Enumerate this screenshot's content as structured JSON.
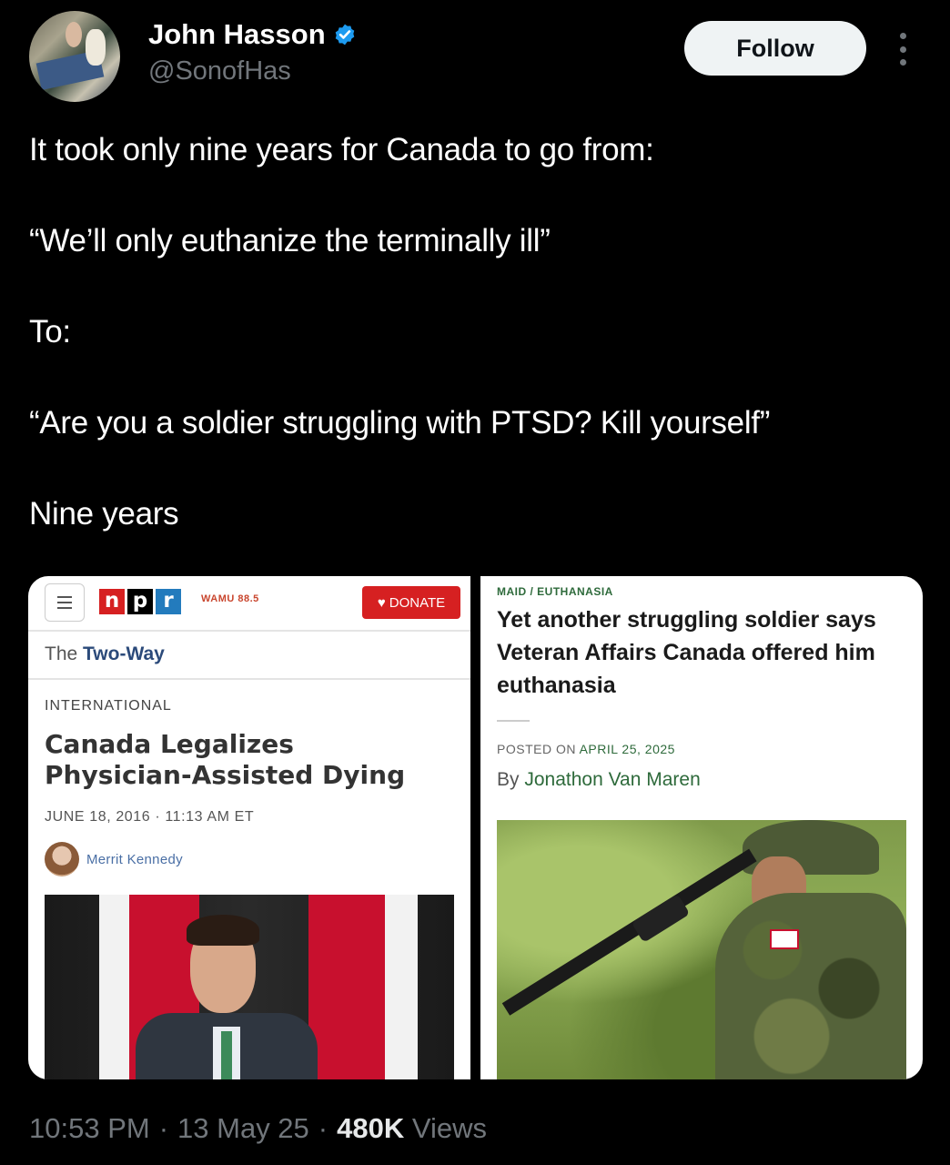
{
  "header": {
    "display_name": "John Hasson",
    "handle": "@SonofHas",
    "follow_label": "Follow",
    "verified_icon": "verified-badge-icon",
    "more_icon": "more-options-icon"
  },
  "tweet": {
    "line1": "It took only nine years for Canada to go from:",
    "line2": "“We’ll only euthanize the terminally ill”",
    "line3": "To:",
    "line4": "“Are you a soldier struggling with PTSD? Kill yourself”",
    "line5": "Nine years"
  },
  "media_left": {
    "logo_letters": [
      "n",
      "p",
      "r"
    ],
    "station": "WAMU 88.5",
    "donate_label": "DONATE",
    "section_prefix": "The",
    "section_name": "Two-Way",
    "kicker": "INTERNATIONAL",
    "headline": "Canada Legalizes Physician-Assisted Dying",
    "date": "JUNE 18, 2016 · 11:13 AM ET",
    "author": "Merrit Kennedy",
    "colors": {
      "npr_red": "#d62021",
      "npr_black": "#000000",
      "npr_blue": "#237bbd"
    }
  },
  "media_right": {
    "kicker": "MAID / EUTHANASIA",
    "headline": "Yet another struggling soldier says Veteran Affairs Canada offered him euthanasia",
    "posted_prefix": "POSTED ON",
    "posted_date": "APRIL 25, 2025",
    "by_prefix": "By",
    "author": "Jonathon Van Maren"
  },
  "footer": {
    "time": "10:53 PM",
    "sep1": "·",
    "date": "13 May 25",
    "sep2": "·",
    "views_count": "480K",
    "views_label": "Views"
  }
}
